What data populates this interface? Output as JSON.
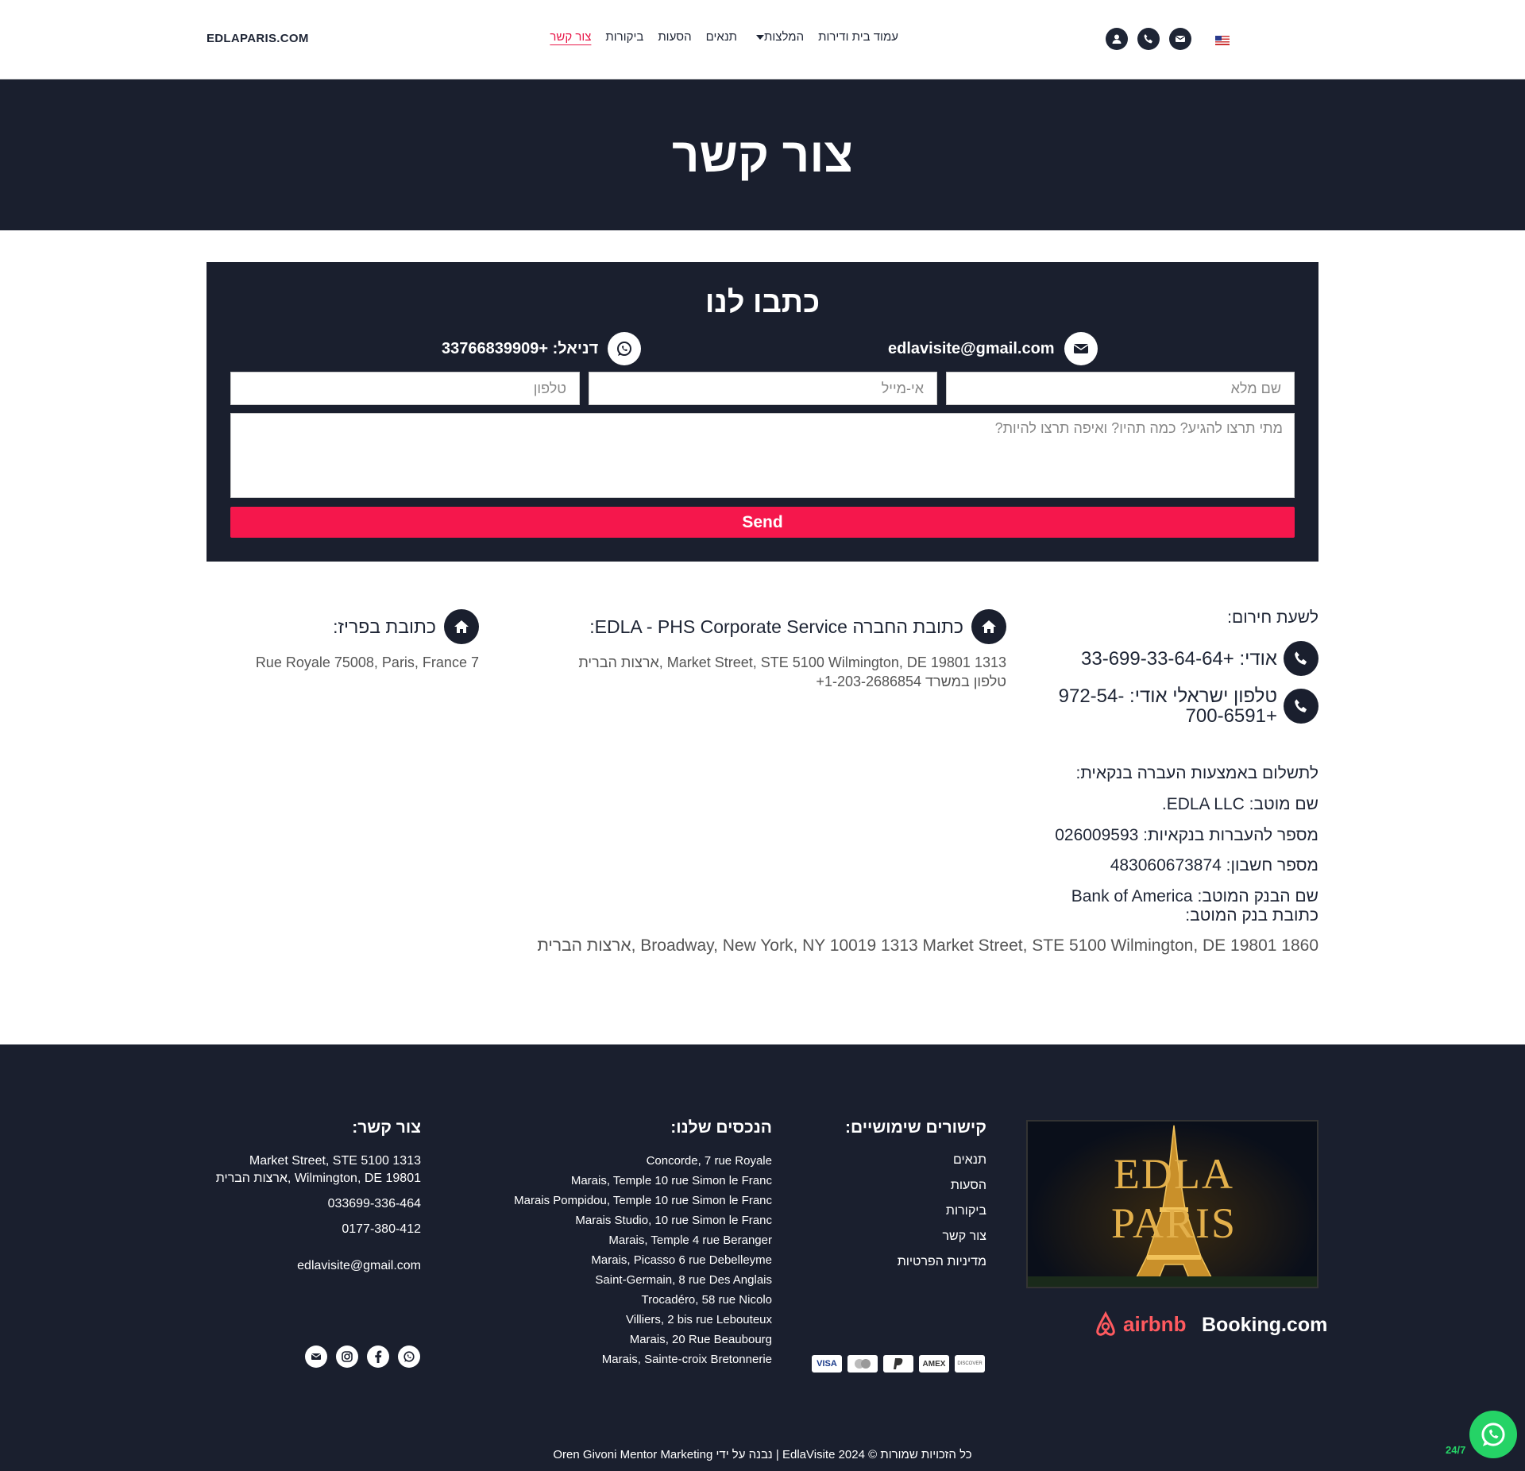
{
  "header": {
    "logo": "EDLAPARIS.COM",
    "nav": [
      "עמוד בית ודירות",
      "המלצות",
      "תנאים",
      "הסעות",
      "ביקורות",
      "צור קשר"
    ],
    "active_nav": "צור קשר"
  },
  "hero": {
    "title": "צור קשר"
  },
  "form": {
    "title": "כתבו לנו",
    "email_contact": "edlavisite@gmail.com",
    "whatsapp_contact": "דניאל: +33766839909",
    "name_placeholder": "שם מלא",
    "email_placeholder": "אי-מייל",
    "phone_placeholder": "טלפון",
    "message_placeholder": "מתי תרצו להגיע? כמה תהיו? ואיפה תרצו להיות?",
    "send_label": "Send"
  },
  "info": {
    "emergency_title": "לשעת חירום:",
    "phone_oudi": "אודי: +33-699-33-64-64",
    "phone_israel_line1": "טלפון ישראלי אודי: -972-54",
    "phone_israel_line2": "+700-6591",
    "company_title": "כתובת החברה EDLA - PHS Corporate Service:",
    "company_line1": "1313 Market Street, STE 5100 Wilmington, DE 19801 ,ארצות הברית",
    "company_line2": "טלפון במשרד 1-203-2686854+",
    "paris_title": "כתובת בפריז:",
    "paris_address": "7 Rue Royale 75008, Paris, France"
  },
  "bank": {
    "title": "לתשלום באמצעות העברה בנקאית:",
    "beneficiary": "שם מוטב: EDLA LLC.",
    "routing": "מספר להעברות בנקאיות: 026009593",
    "account": "מספר חשבון: 483060673874",
    "bank_name": "שם הבנק המוטב: Bank of America",
    "bank_address_label": "כתובת בנק המוטב:",
    "bank_address": "1860 Broadway, New York, NY 10019 1313 Market Street, STE 5100 Wilmington, DE 19801 ,ארצות הברית"
  },
  "footer": {
    "links_title": "קישורים שימושיים:",
    "links": [
      "תנאים",
      "הסעות",
      "ביקורות",
      "צור קשר",
      "מדיניות הפרטיות"
    ],
    "props_title": "הנכסים שלנו:",
    "properties": [
      "Concorde, 7 rue Royale",
      "Marais, Temple 10 rue Simon le Franc",
      "Marais Pompidou, Temple 10 rue Simon le Franc",
      "Marais Studio, 10 rue Simon le Franc",
      "Marais, Temple 4 rue Beranger",
      "Marais, Picasso 6 rue Debelleyme",
      "Saint-Germain, 8 rue Des Anglais",
      "Trocadéro, 58 rue Nicolo",
      "Villiers, 2 bis rue Lebouteux",
      "Marais, 20 Rue Beaubourg",
      "Marais, Sainte-croix Bretonnerie"
    ],
    "contact_title": "צור קשר:",
    "contact_addr1": "1313 Market Street, STE 5100",
    "contact_addr2": "Wilmington, DE 19801 ,ארצות הברית",
    "contact_phone1": "033699-336-464",
    "contact_phone2": "0177-380-412",
    "contact_email": "edlavisite@gmail.com",
    "brand_image_text": "EDLA PARIS",
    "partners": [
      "airbnb",
      "Booking.com"
    ],
    "payments": [
      "VISA",
      "MC",
      "PayPal",
      "AMEX",
      "DISCOVER"
    ],
    "copyright": "כל הזכויות שמורות © EdlaVisite 2024 | נבנה על ידי Oren Givoni Mentor Marketing",
    "wa_label": "24/7"
  },
  "colors": {
    "accent": "#f5174c",
    "dark": "#1a1f2e",
    "whatsapp": "#25d366"
  }
}
